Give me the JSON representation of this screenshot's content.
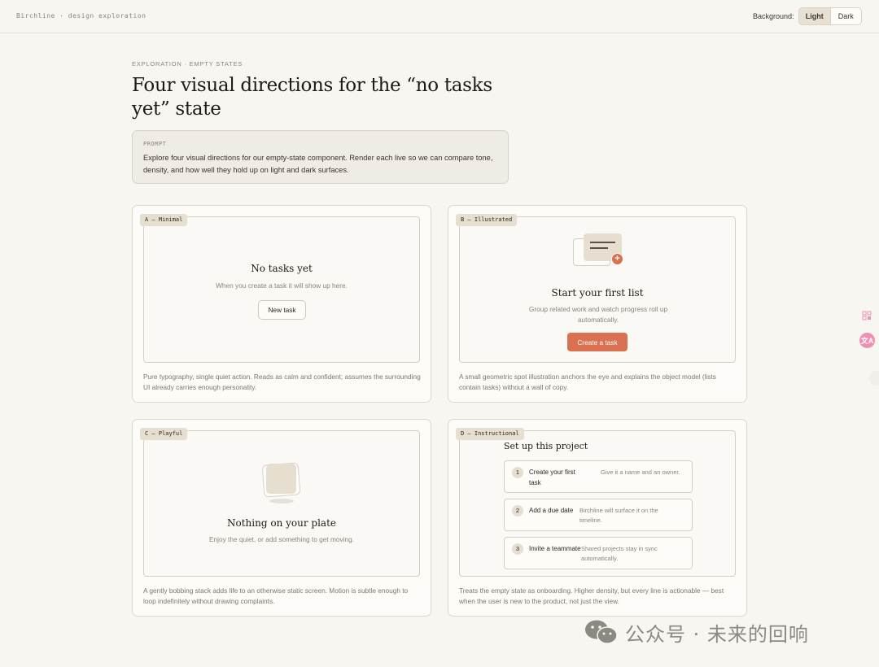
{
  "topbar": {
    "brand": "Birchline · design exploration",
    "background_label": "Background:",
    "options": [
      "Light",
      "Dark"
    ],
    "selected": "Light"
  },
  "header": {
    "eyebrow": "EXPLORATION · EMPTY STATES",
    "title": "Four visual directions for the “no tasks yet” state"
  },
  "prompt": {
    "label": "PROMPT",
    "text": "Explore four visual directions for our empty-state component. Render each live so we can compare tone, density, and how well they hold up on light and dark surfaces."
  },
  "cards": {
    "a": {
      "tag": "A — Minimal",
      "heading": "No tasks yet",
      "subtext": "When you create a task it will show up here.",
      "button": "New task",
      "description": "Pure typography, single quiet action. Reads as calm and confident; assumes the surrounding UI already carries enough personality."
    },
    "b": {
      "tag": "B — Illustrated",
      "heading": "Start your first list",
      "subtext": "Group related work and watch progress roll up automatically.",
      "button": "Create a task",
      "description": "A small geometric spot illustration anchors the eye and explains the object model (lists contain tasks) without a wall of copy."
    },
    "c": {
      "tag": "C — Playful",
      "heading": "Nothing on your plate",
      "subtext": "Enjoy the quiet, or add something to get moving.",
      "description": "A gently bobbing stack adds life to an otherwise static screen. Motion is subtle enough to loop indefinitely without drawing complaints."
    },
    "d": {
      "tag": "D — Instructional",
      "heading": "Set up this project",
      "steps": [
        {
          "num": "1",
          "title": "Create your first task",
          "desc": "Give it a name and an owner."
        },
        {
          "num": "2",
          "title": "Add a due date",
          "desc": "Birchline will surface it on the timeline."
        },
        {
          "num": "3",
          "title": "Invite a teammate",
          "desc": "Shared projects stay in sync automatically."
        }
      ],
      "description": "Treats the empty state as onboarding. Higher density, but every line is actionable — best when the user is new to the product, not just the view."
    }
  },
  "floating": {
    "translate_glyph": "文A"
  },
  "watermark": {
    "text": "公众号 · 未来的回响"
  },
  "colors": {
    "accent": "#d9704f",
    "tag_bg": "#e6dfd0",
    "page_bg": "#f8f6f1"
  }
}
